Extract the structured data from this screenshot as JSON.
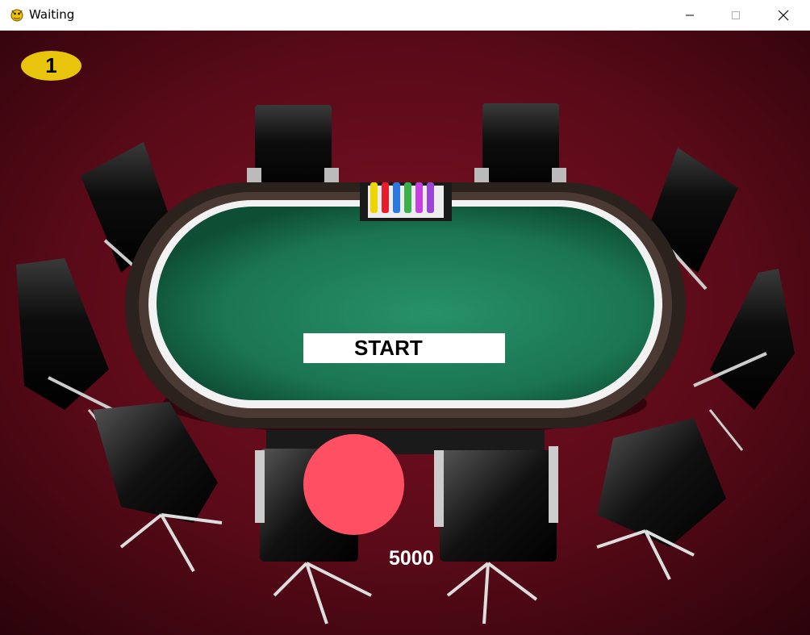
{
  "window": {
    "title": "Waiting",
    "icon": "pygame-snake-icon",
    "controls": [
      "minimize-icon",
      "maximize-icon",
      "close-icon"
    ]
  },
  "hud": {
    "round": "1",
    "start_label": "START",
    "chips": "5000"
  },
  "colors": {
    "felt": "#1e7a55",
    "carpet": "#6e0b1c",
    "badge": "#e8c40c",
    "player_token": "#ff5063"
  }
}
